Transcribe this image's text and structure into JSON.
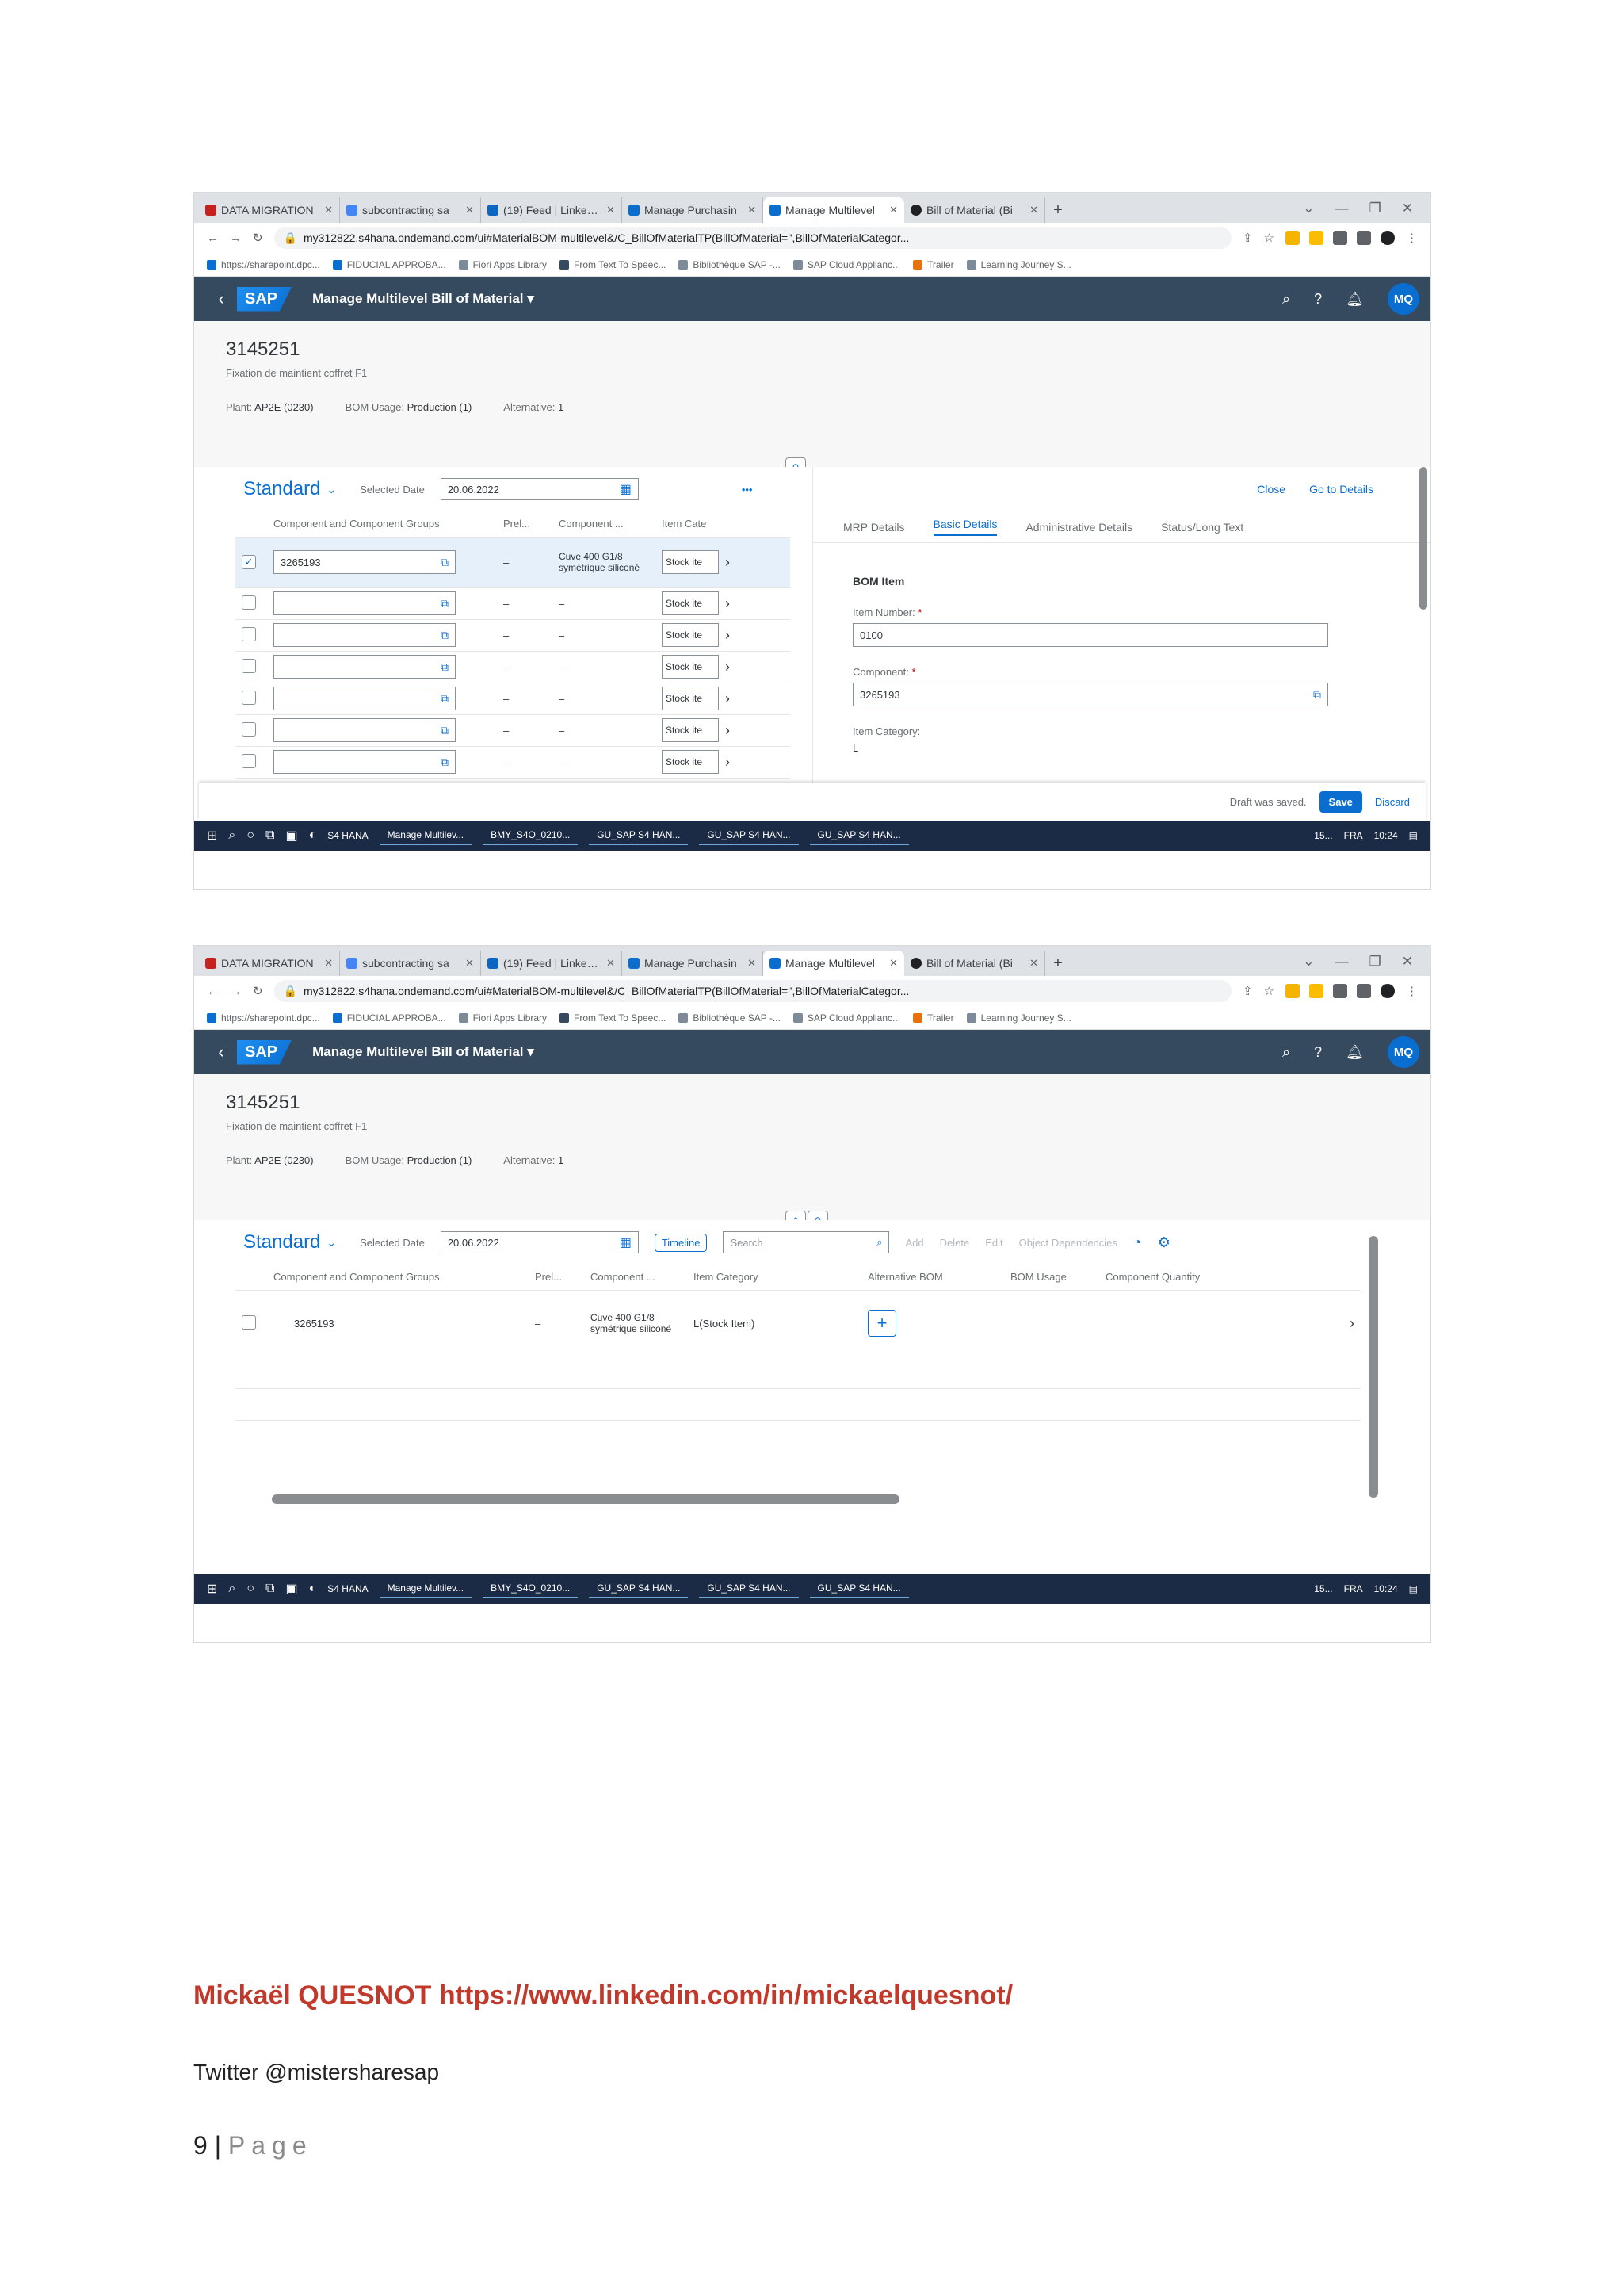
{
  "browser": {
    "tabs": [
      {
        "label": "DATA MIGRATION",
        "color": "#c5221f"
      },
      {
        "label": "subcontracting sa",
        "color": "#4285f4"
      },
      {
        "label": "(19) Feed | LinkedIn",
        "color": "#0a66c2"
      },
      {
        "label": "Manage Purchasin",
        "color": "#0a6ed1"
      },
      {
        "label": "Manage Multilevel",
        "color": "#0a6ed1"
      },
      {
        "label": "Bill of Material (Bi",
        "color": "#202124"
      }
    ],
    "new_tab": "+",
    "url": "my312822.s4hana.ondemand.com/ui#MaterialBOM-multilevel&/C_BillOfMaterialTP(BillOfMaterial='',BillOfMaterialCategor...",
    "bookmarks": [
      "https://sharepoint.dpc...",
      "FIDUCIAL APPROBA...",
      "Fiori Apps Library",
      "From Text To Speec...",
      "Bibliothèque SAP -...",
      "SAP Cloud Applianc...",
      "Trailer",
      "Learning Journey S..."
    ]
  },
  "shell": {
    "back": "‹",
    "logo": "SAP",
    "app_title": "Manage Multilevel Bill of Material ▾",
    "avatar": "MQ"
  },
  "object": {
    "title": "3145251",
    "subtitle": "Fixation de maintient coffret F1",
    "plant_label": "Plant:",
    "plant_value": "AP2E (0230)",
    "usage_label": "BOM Usage:",
    "usage_value": "Production (1)",
    "alt_label": "Alternative:",
    "alt_value": "1"
  },
  "toolbar": {
    "variant": "Standard",
    "date_label": "Selected Date",
    "date_value": "20.06.2022",
    "more": "•••",
    "timeline": "Timeline",
    "search_placeholder": "Search",
    "add": "Add",
    "delete": "Delete",
    "edit": "Edit",
    "object_dependencies": "Object Dependencies"
  },
  "table1": {
    "headers": [
      "Component and Component Groups",
      "Prel...",
      "Component ...",
      "Item Cate"
    ],
    "first_row": {
      "component": "3265193",
      "prel": "–",
      "desc": "Cuve 400 G1/8 symétrique siliconé",
      "cat": "Stock ite"
    },
    "empty_rows": [
      {
        "prel": "–",
        "desc": "–",
        "cat": "Stock ite"
      },
      {
        "prel": "–",
        "desc": "–",
        "cat": "Stock ite"
      },
      {
        "prel": "–",
        "desc": "–",
        "cat": "Stock ite"
      },
      {
        "prel": "–",
        "desc": "–",
        "cat": "Stock ite"
      },
      {
        "prel": "–",
        "desc": "–",
        "cat": "Stock ite"
      },
      {
        "prel": "–",
        "desc": "–",
        "cat": "Stock ite"
      }
    ]
  },
  "detail": {
    "close": "Close",
    "go_to_details": "Go to Details",
    "tabs": [
      "MRP Details",
      "Basic Details",
      "Administrative Details",
      "Status/Long Text"
    ],
    "active_tab": "Basic Details",
    "section": "BOM Item",
    "item_number_label": "Item Number:",
    "item_number_value": "0100",
    "component_label": "Component:",
    "component_value": "3265193",
    "item_category_label": "Item Category:",
    "item_category_value": "L"
  },
  "footer": {
    "draft_saved": "Draft was saved.",
    "save": "Save",
    "discard": "Discard"
  },
  "table2": {
    "headers": [
      "Component and Component Groups",
      "Prel...",
      "Component ...",
      "Item Category",
      "Alternative BOM",
      "BOM Usage",
      "Component Quantity"
    ],
    "row": {
      "component": "3265193",
      "prel": "–",
      "desc": "Cuve 400 G1/8 symétrique siliconé",
      "cat": "L(Stock Item)",
      "alt_bom": "+"
    }
  },
  "taskbar": {
    "items": [
      "S4 HANA",
      "Manage Multilev...",
      "BMY_S4O_0210...",
      "GU_SAP S4 HAN...",
      "GU_SAP S4 HAN...",
      "GU_SAP S4 HAN..."
    ],
    "right": [
      "15...",
      "FRA",
      "10:24"
    ]
  },
  "page_footer": {
    "author": "Mickaël QUESNOT https://www.linkedin.com/in/mickaelquesnot/",
    "twitter": "Twitter @mistersharesap",
    "page_number": "9",
    "separator": "|",
    "page_word": "Page"
  },
  "colors": {
    "shell": "#354a5f",
    "accent": "#0a6ed1",
    "author": "#c0392b"
  }
}
